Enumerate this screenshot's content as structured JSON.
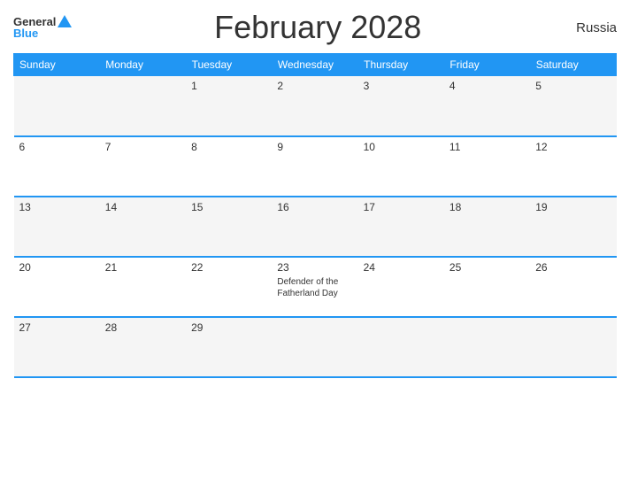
{
  "header": {
    "title": "February 2028",
    "country": "Russia",
    "logo": {
      "general": "General",
      "blue": "Blue"
    }
  },
  "calendar": {
    "weekdays": [
      "Sunday",
      "Monday",
      "Tuesday",
      "Wednesday",
      "Thursday",
      "Friday",
      "Saturday"
    ],
    "weeks": [
      [
        {
          "day": "",
          "holiday": ""
        },
        {
          "day": "",
          "holiday": ""
        },
        {
          "day": "1",
          "holiday": ""
        },
        {
          "day": "2",
          "holiday": ""
        },
        {
          "day": "3",
          "holiday": ""
        },
        {
          "day": "4",
          "holiday": ""
        },
        {
          "day": "5",
          "holiday": ""
        }
      ],
      [
        {
          "day": "6",
          "holiday": ""
        },
        {
          "day": "7",
          "holiday": ""
        },
        {
          "day": "8",
          "holiday": ""
        },
        {
          "day": "9",
          "holiday": ""
        },
        {
          "day": "10",
          "holiday": ""
        },
        {
          "day": "11",
          "holiday": ""
        },
        {
          "day": "12",
          "holiday": ""
        }
      ],
      [
        {
          "day": "13",
          "holiday": ""
        },
        {
          "day": "14",
          "holiday": ""
        },
        {
          "day": "15",
          "holiday": ""
        },
        {
          "day": "16",
          "holiday": ""
        },
        {
          "day": "17",
          "holiday": ""
        },
        {
          "day": "18",
          "holiday": ""
        },
        {
          "day": "19",
          "holiday": ""
        }
      ],
      [
        {
          "day": "20",
          "holiday": ""
        },
        {
          "day": "21",
          "holiday": ""
        },
        {
          "day": "22",
          "holiday": ""
        },
        {
          "day": "23",
          "holiday": "Defender of the Fatherland Day"
        },
        {
          "day": "24",
          "holiday": ""
        },
        {
          "day": "25",
          "holiday": ""
        },
        {
          "day": "26",
          "holiday": ""
        }
      ],
      [
        {
          "day": "27",
          "holiday": ""
        },
        {
          "day": "28",
          "holiday": ""
        },
        {
          "day": "29",
          "holiday": ""
        },
        {
          "day": "",
          "holiday": ""
        },
        {
          "day": "",
          "holiday": ""
        },
        {
          "day": "",
          "holiday": ""
        },
        {
          "day": "",
          "holiday": ""
        }
      ]
    ]
  }
}
